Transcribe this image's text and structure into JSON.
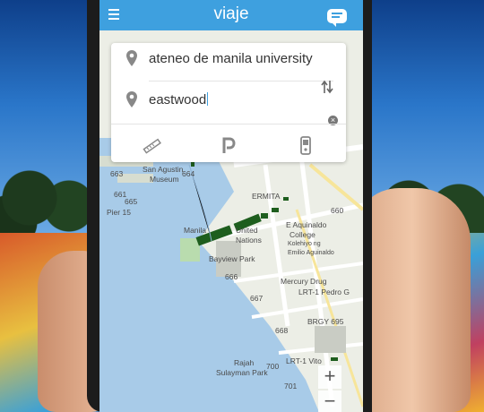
{
  "app": {
    "title": "viaje"
  },
  "route": {
    "origin": "ateneo de manila university",
    "destination": "eastwood"
  },
  "modes": [
    "ruler-icon",
    "parking-icon",
    "train-icon"
  ],
  "map_labels": {
    "san_agustin": "San Agustin",
    "museum": "Museum",
    "ermita": "ERMITA",
    "pier15": "Pier 15",
    "manila": "Manila",
    "un": "United",
    "un2": "Nations",
    "ea1": "E Aquinaldo",
    "ea2": "College",
    "ea3": "Kolehiyo ng",
    "ea4": "Emilio Aguinaldo",
    "bayview": "Bayview Park",
    "mercury": "Mercury Drug",
    "lrt_pedro": "LRT-1 Pedro G",
    "brgy": "BRGY 695",
    "rajah": "Rajah",
    "sulayman": "Sulayman Park",
    "lrt_vito": "LRT-1 Vito",
    "n663": "663",
    "n664": "664",
    "n661": "661",
    "n665": "665",
    "n660": "660",
    "n666": "666",
    "n667": "667",
    "n668": "668",
    "n700": "700",
    "n701": "701"
  },
  "zoom": {
    "in": "+",
    "out": "−"
  },
  "colors": {
    "topbar": "#3ea0df",
    "route": "#1e5e1e"
  }
}
